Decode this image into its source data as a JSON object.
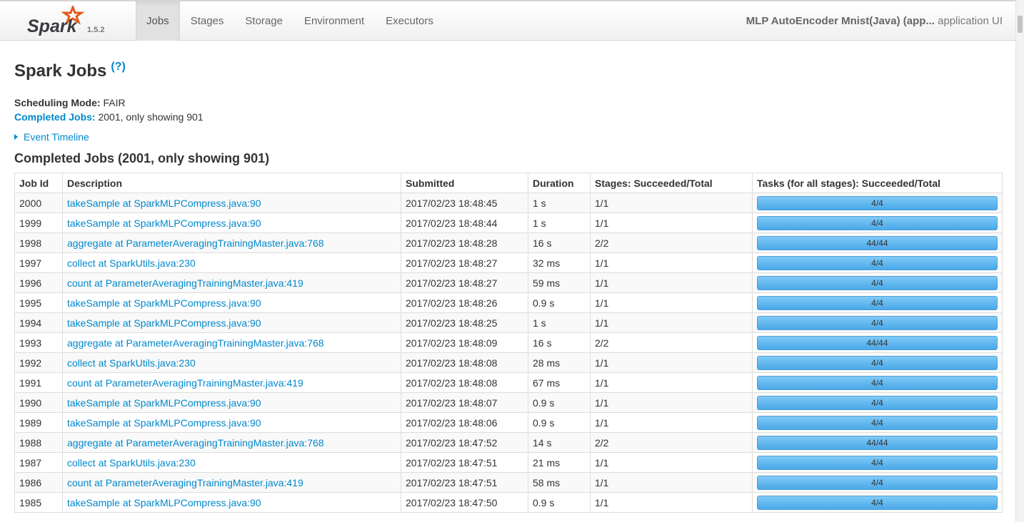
{
  "header": {
    "brand": "Spark",
    "version": "1.5.2",
    "tabs": [
      {
        "label": "Jobs",
        "active": true
      },
      {
        "label": "Stages",
        "active": false
      },
      {
        "label": "Storage",
        "active": false
      },
      {
        "label": "Environment",
        "active": false
      },
      {
        "label": "Executors",
        "active": false
      }
    ],
    "app_name": "MLP AutoEncoder Mnist(Java) (app...",
    "app_suffix": " application UI"
  },
  "page": {
    "title": "Spark Jobs",
    "help": "(?)",
    "scheduling_label": "Scheduling Mode:",
    "scheduling_value": "FAIR",
    "completed_label": "Completed Jobs:",
    "completed_value": "2001, only showing 901",
    "timeline_label": "Event Timeline",
    "section_title": "Completed Jobs (2001, only showing 901)"
  },
  "colors": {
    "link": "#0088cc",
    "progress_fill": "#4aa8e8",
    "progress_border": "#4f9fd6"
  },
  "table": {
    "columns": [
      "Job Id",
      "Description",
      "Submitted",
      "Duration",
      "Stages: Succeeded/Total",
      "Tasks (for all stages): Succeeded/Total"
    ],
    "rows": [
      {
        "id": "2000",
        "desc": "takeSample at SparkMLPCompress.java:90",
        "submitted": "2017/02/23 18:48:45",
        "duration": "1 s",
        "stages": "1/1",
        "tasks": "4/4",
        "progress": 1.0
      },
      {
        "id": "1999",
        "desc": "takeSample at SparkMLPCompress.java:90",
        "submitted": "2017/02/23 18:48:44",
        "duration": "1 s",
        "stages": "1/1",
        "tasks": "4/4",
        "progress": 1.0
      },
      {
        "id": "1998",
        "desc": "aggregate at ParameterAveragingTrainingMaster.java:768",
        "submitted": "2017/02/23 18:48:28",
        "duration": "16 s",
        "stages": "2/2",
        "tasks": "44/44",
        "progress": 1.0
      },
      {
        "id": "1997",
        "desc": "collect at SparkUtils.java:230",
        "submitted": "2017/02/23 18:48:27",
        "duration": "32 ms",
        "stages": "1/1",
        "tasks": "4/4",
        "progress": 1.0
      },
      {
        "id": "1996",
        "desc": "count at ParameterAveragingTrainingMaster.java:419",
        "submitted": "2017/02/23 18:48:27",
        "duration": "59 ms",
        "stages": "1/1",
        "tasks": "4/4",
        "progress": 1.0
      },
      {
        "id": "1995",
        "desc": "takeSample at SparkMLPCompress.java:90",
        "submitted": "2017/02/23 18:48:26",
        "duration": "0.9 s",
        "stages": "1/1",
        "tasks": "4/4",
        "progress": 1.0
      },
      {
        "id": "1994",
        "desc": "takeSample at SparkMLPCompress.java:90",
        "submitted": "2017/02/23 18:48:25",
        "duration": "1 s",
        "stages": "1/1",
        "tasks": "4/4",
        "progress": 1.0
      },
      {
        "id": "1993",
        "desc": "aggregate at ParameterAveragingTrainingMaster.java:768",
        "submitted": "2017/02/23 18:48:09",
        "duration": "16 s",
        "stages": "2/2",
        "tasks": "44/44",
        "progress": 1.0
      },
      {
        "id": "1992",
        "desc": "collect at SparkUtils.java:230",
        "submitted": "2017/02/23 18:48:08",
        "duration": "28 ms",
        "stages": "1/1",
        "tasks": "4/4",
        "progress": 1.0
      },
      {
        "id": "1991",
        "desc": "count at ParameterAveragingTrainingMaster.java:419",
        "submitted": "2017/02/23 18:48:08",
        "duration": "67 ms",
        "stages": "1/1",
        "tasks": "4/4",
        "progress": 1.0
      },
      {
        "id": "1990",
        "desc": "takeSample at SparkMLPCompress.java:90",
        "submitted": "2017/02/23 18:48:07",
        "duration": "0.9 s",
        "stages": "1/1",
        "tasks": "4/4",
        "progress": 1.0
      },
      {
        "id": "1989",
        "desc": "takeSample at SparkMLPCompress.java:90",
        "submitted": "2017/02/23 18:48:06",
        "duration": "0.9 s",
        "stages": "1/1",
        "tasks": "4/4",
        "progress": 1.0
      },
      {
        "id": "1988",
        "desc": "aggregate at ParameterAveragingTrainingMaster.java:768",
        "submitted": "2017/02/23 18:47:52",
        "duration": "14 s",
        "stages": "2/2",
        "tasks": "44/44",
        "progress": 1.0
      },
      {
        "id": "1987",
        "desc": "collect at SparkUtils.java:230",
        "submitted": "2017/02/23 18:47:51",
        "duration": "21 ms",
        "stages": "1/1",
        "tasks": "4/4",
        "progress": 1.0
      },
      {
        "id": "1986",
        "desc": "count at ParameterAveragingTrainingMaster.java:419",
        "submitted": "2017/02/23 18:47:51",
        "duration": "58 ms",
        "stages": "1/1",
        "tasks": "4/4",
        "progress": 1.0
      },
      {
        "id": "1985",
        "desc": "takeSample at SparkMLPCompress.java:90",
        "submitted": "2017/02/23 18:47:50",
        "duration": "0.9 s",
        "stages": "1/1",
        "tasks": "4/4",
        "progress": 1.0
      }
    ]
  }
}
